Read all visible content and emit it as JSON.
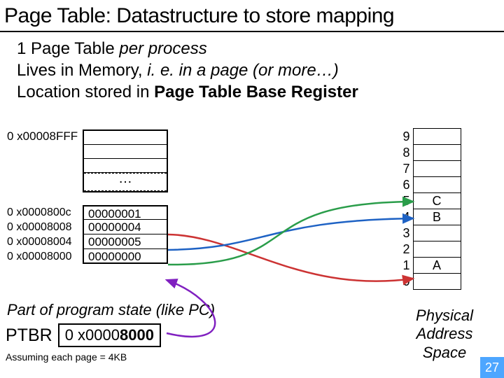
{
  "title": "Page Table: Datastructure to store mapping",
  "bullet1_a": "1 Page Table ",
  "bullet1_b": "per process",
  "bullet2_a": "Lives in Memory, ",
  "bullet2_b": "i. e. in a page (or more…)",
  "bullet3_a": "Location stored in ",
  "bullet3_b": "Page Table Base Register",
  "pt_top_addr": "0 x00008FFF",
  "pt_dots": "…",
  "pt_entries": [
    {
      "addr": "0 x0000800c",
      "val": "00000001"
    },
    {
      "addr": "0 x00008008",
      "val": "00000004"
    },
    {
      "addr": "0 x00008004",
      "val": "00000005"
    },
    {
      "addr": "0 x00008000",
      "val": "00000000"
    }
  ],
  "caption_state": "Part of program state (like PC)",
  "ptbr_label": "PTBR",
  "ptbr_value_a": "0 x0000",
  "ptbr_value_b": "8000",
  "assume": "Assuming each page = 4KB",
  "phys_pages": [
    {
      "n": "9",
      "label": ""
    },
    {
      "n": "8",
      "label": ""
    },
    {
      "n": "7",
      "label": ""
    },
    {
      "n": "6",
      "label": ""
    },
    {
      "n": "5",
      "label": "C"
    },
    {
      "n": "4",
      "label": "B"
    },
    {
      "n": "3",
      "label": ""
    },
    {
      "n": "2",
      "label": ""
    },
    {
      "n": "1",
      "label": "A"
    },
    {
      "n": "0",
      "label": ""
    }
  ],
  "phys_caption": "Physical Address Space",
  "slide_number": "27",
  "arrow_colors": {
    "ptbr_to_table": "#8020c0",
    "a_arrow": "#cc3333",
    "b_arrow": "#1e62c4",
    "c_arrow": "#2a9d4a"
  }
}
